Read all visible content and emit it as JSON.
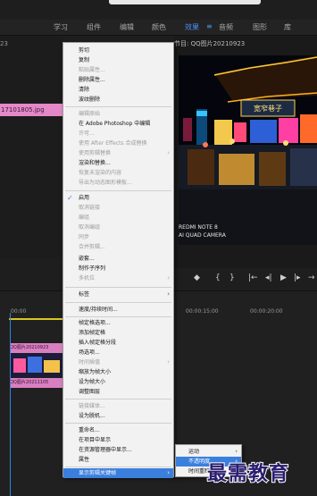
{
  "workspaces": [
    {
      "label": "学习",
      "active": false
    },
    {
      "label": "组件",
      "active": false
    },
    {
      "label": "编辑",
      "active": false
    },
    {
      "label": "颜色",
      "active": false
    },
    {
      "label": "效果",
      "active": true
    },
    {
      "label": "音频",
      "active": false
    },
    {
      "label": "图形",
      "active": false
    },
    {
      "label": "库",
      "active": false
    }
  ],
  "left_panel": {
    "header_fragment": "23",
    "clip_name": "17101805.jpg"
  },
  "program_monitor": {
    "title": "节目: QQ图片20210923",
    "watermark_line1": "REDMI NOTE 8",
    "watermark_line2": "AI QUAD CAMERA",
    "sign_text": "宽窄巷子"
  },
  "timeline": {
    "times": [
      "00:00",
      "00:00:15:00",
      "00:00:20:00"
    ],
    "clip_top": "QQ图片20210923",
    "clip_bottom": "QQ图片20211105"
  },
  "context_menu": {
    "items": [
      {
        "label": "剪切",
        "enabled": true
      },
      {
        "label": "复制",
        "enabled": true
      },
      {
        "label": "粘贴属性...",
        "enabled": false
      },
      {
        "label": "删除属性...",
        "enabled": true
      },
      {
        "label": "清除",
        "enabled": true
      },
      {
        "label": "波纹删除",
        "enabled": true
      },
      {
        "label": "编辑原始",
        "enabled": false
      },
      {
        "label": "在 Adobe Photoshop 中编辑",
        "enabled": true
      },
      {
        "label": "许可...",
        "enabled": false
      },
      {
        "label": "使用 After Effects 合成替换",
        "enabled": false
      },
      {
        "label": "使用剪辑替换",
        "enabled": false,
        "submenu": true
      },
      {
        "label": "渲染和替换...",
        "enabled": true
      },
      {
        "label": "恢复未渲染的内容",
        "enabled": false
      },
      {
        "label": "导出为动态图形模板...",
        "enabled": false
      },
      {
        "label": "启用",
        "enabled": true,
        "checked": true
      },
      {
        "label": "取消链接",
        "enabled": false
      },
      {
        "label": "编组",
        "enabled": false
      },
      {
        "label": "取消编组",
        "enabled": false
      },
      {
        "label": "同步",
        "enabled": false
      },
      {
        "label": "合并剪辑...",
        "enabled": false
      },
      {
        "label": "嵌套...",
        "enabled": true
      },
      {
        "label": "制作子序列",
        "enabled": true
      },
      {
        "label": "多机位",
        "enabled": false,
        "submenu": true
      },
      {
        "label": "标签",
        "enabled": true,
        "submenu": true
      },
      {
        "label": "速度/持续时间...",
        "enabled": true
      },
      {
        "label": "帧定格选项...",
        "enabled": true
      },
      {
        "label": "添加帧定格",
        "enabled": true
      },
      {
        "label": "插入帧定格分段",
        "enabled": true
      },
      {
        "label": "场选项...",
        "enabled": true
      },
      {
        "label": "时间插值",
        "enabled": false,
        "submenu": true
      },
      {
        "label": "缩放为帧大小",
        "enabled": true
      },
      {
        "label": "设为帧大小",
        "enabled": true
      },
      {
        "label": "调整图层",
        "enabled": true
      },
      {
        "label": "链接媒体...",
        "enabled": false
      },
      {
        "label": "设为脱机...",
        "enabled": true
      },
      {
        "label": "重命名...",
        "enabled": true
      },
      {
        "label": "在项目中显示",
        "enabled": true
      },
      {
        "label": "在资源管理器中显示...",
        "enabled": true
      },
      {
        "label": "属性",
        "enabled": true
      },
      {
        "label": "显示剪辑关键帧",
        "enabled": true,
        "submenu": true,
        "highlighted": true
      }
    ]
  },
  "submenu": {
    "items": [
      {
        "label": "运动",
        "submenu": true,
        "highlighted": false
      },
      {
        "label": "不透明度",
        "submenu": true,
        "highlighted": true
      },
      {
        "label": "时间重映射",
        "submenu": true,
        "highlighted": false
      }
    ]
  },
  "brand": {
    "text": "最需教育"
  }
}
